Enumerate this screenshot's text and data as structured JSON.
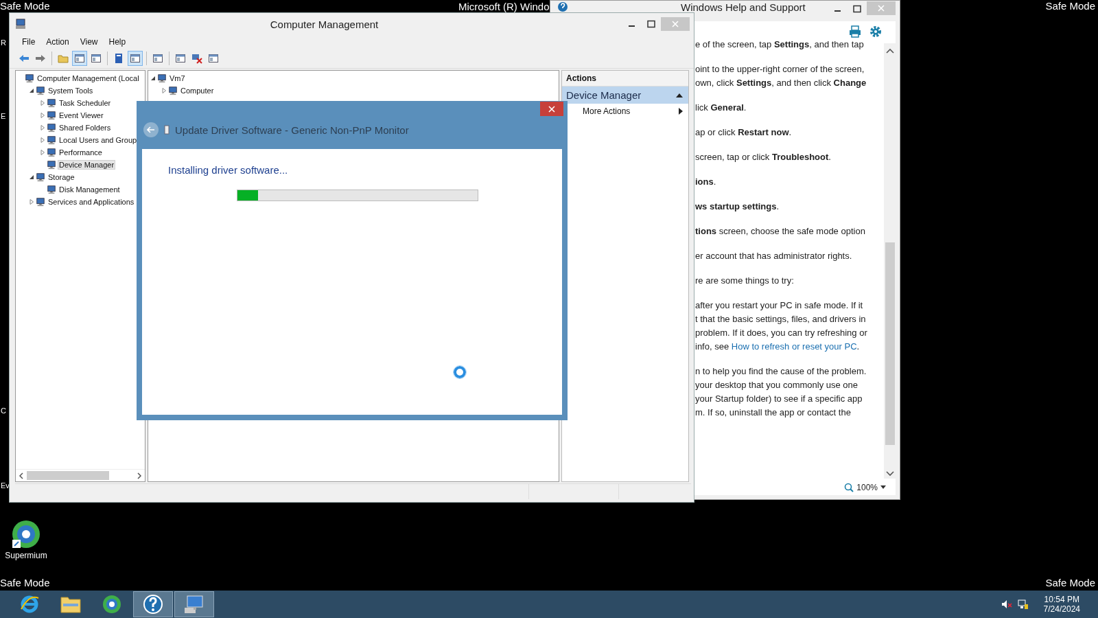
{
  "desktop": {
    "safe_mode_labels": [
      "Safe Mode",
      "Safe Mode",
      "Safe Mode",
      "Safe Mode"
    ],
    "banner": "Microsoft (R) Windo",
    "edge_letters": [
      "R",
      "E",
      "C",
      "Ev"
    ],
    "icons": [
      {
        "label": "Supermium"
      }
    ]
  },
  "help_window": {
    "title": "Windows Help and Support",
    "zoom": "100%",
    "paragraphs": [
      {
        "lines": [
          {
            "text": "e of the screen, tap **Settings**, and then tap"
          }
        ]
      },
      {
        "lines": [
          {
            "text": "oint to the upper-right corner of the screen,"
          },
          {
            "text": "own, click **Settings**, and then click **Change**"
          }
        ]
      },
      {
        "lines": [
          {
            "text": "lick **General**."
          }
        ]
      },
      {
        "lines": [
          {
            "text": "ap or click **Restart now**."
          }
        ]
      },
      {
        "lines": [
          {
            "text": "screen, tap or click **Troubleshoot**."
          }
        ]
      },
      {
        "lines": [
          {
            "text": "**ions**."
          }
        ]
      },
      {
        "lines": [
          {
            "text": "**ws startup settings**."
          }
        ]
      },
      {
        "lines": [
          {
            "text": "**tions** screen, choose the safe mode option"
          }
        ]
      },
      {
        "lines": [
          {
            "text": "er account that has administrator rights."
          }
        ]
      },
      {
        "lines": [
          {
            "text": "re are some things to try:"
          }
        ]
      },
      {
        "lines": [
          {
            "text": "after you restart your PC in safe mode. If it"
          },
          {
            "text": "t that the basic settings, files, and drivers in"
          },
          {
            "text": "problem. If it does, you can try refreshing or"
          },
          {
            "text": "info, see ",
            "link": "How to refresh or reset your PC",
            "after": "."
          }
        ]
      },
      {
        "lines": [
          {
            "text": "n to help you find the cause of the problem."
          },
          {
            "text": "your desktop that you commonly use one"
          },
          {
            "text": "your Startup folder) to see if a specific app"
          },
          {
            "text": "m. If so, uninstall the app or contact the"
          }
        ]
      }
    ]
  },
  "main_window": {
    "title": "Computer Management",
    "menu": [
      "File",
      "Action",
      "View",
      "Help"
    ],
    "toolbar_groups": [
      [
        {
          "kind": "back",
          "pressed": false
        },
        {
          "kind": "forward",
          "pressed": false
        }
      ],
      [
        {
          "kind": "folder",
          "pressed": false
        },
        {
          "kind": "window",
          "pressed": true
        },
        {
          "kind": "window",
          "pressed": false
        }
      ],
      [
        {
          "kind": "book",
          "pressed": false
        },
        {
          "kind": "window",
          "pressed": true
        }
      ],
      [
        {
          "kind": "window",
          "pressed": false
        }
      ],
      [
        {
          "kind": "window",
          "pressed": false
        },
        {
          "kind": "delete",
          "pressed": false
        },
        {
          "kind": "window",
          "pressed": false
        }
      ]
    ],
    "tree": [
      {
        "label": "Computer Management (Local",
        "selected": false,
        "children": [
          {
            "label": "System Tools",
            "expanded": true,
            "selected": false,
            "children": [
              {
                "label": "Task Scheduler",
                "expanded": false,
                "selected": false
              },
              {
                "label": "Event Viewer",
                "expanded": false,
                "selected": false
              },
              {
                "label": "Shared Folders",
                "expanded": false,
                "selected": false
              },
              {
                "label": "Local Users and Group",
                "expanded": false,
                "selected": false
              },
              {
                "label": "Performance",
                "expanded": false,
                "selected": false
              },
              {
                "label": "Device Manager",
                "selected": true
              }
            ]
          },
          {
            "label": "Storage",
            "expanded": true,
            "selected": false,
            "children": [
              {
                "label": "Disk Management",
                "selected": false
              }
            ]
          },
          {
            "label": "Services and Applications",
            "expanded": false,
            "selected": false
          }
        ]
      }
    ],
    "content_tree": [
      {
        "label": "Vm7",
        "expanded": true,
        "selected": false,
        "children": [
          {
            "label": "Computer",
            "expanded": false,
            "selected": false
          }
        ]
      }
    ],
    "actions": {
      "header": "Actions",
      "section": {
        "label": "Device Manager",
        "expanded": true
      },
      "items": [
        {
          "label": "More Actions"
        }
      ]
    }
  },
  "dialog": {
    "title": "Update Driver Software - Generic Non-PnP Monitor",
    "back_disabled": true,
    "heading": "Installing driver software...",
    "progress": {
      "level": 0.085
    }
  },
  "taskbar": {
    "apps": [
      {
        "kind": "browser",
        "running": false
      },
      {
        "kind": "folder",
        "running": false
      },
      {
        "kind": "globe",
        "running": false
      },
      {
        "kind": "help",
        "running": true
      },
      {
        "kind": "computer",
        "running": true
      }
    ],
    "clock": {
      "time": "10:54 PM",
      "date": "7/24/2024"
    }
  }
}
